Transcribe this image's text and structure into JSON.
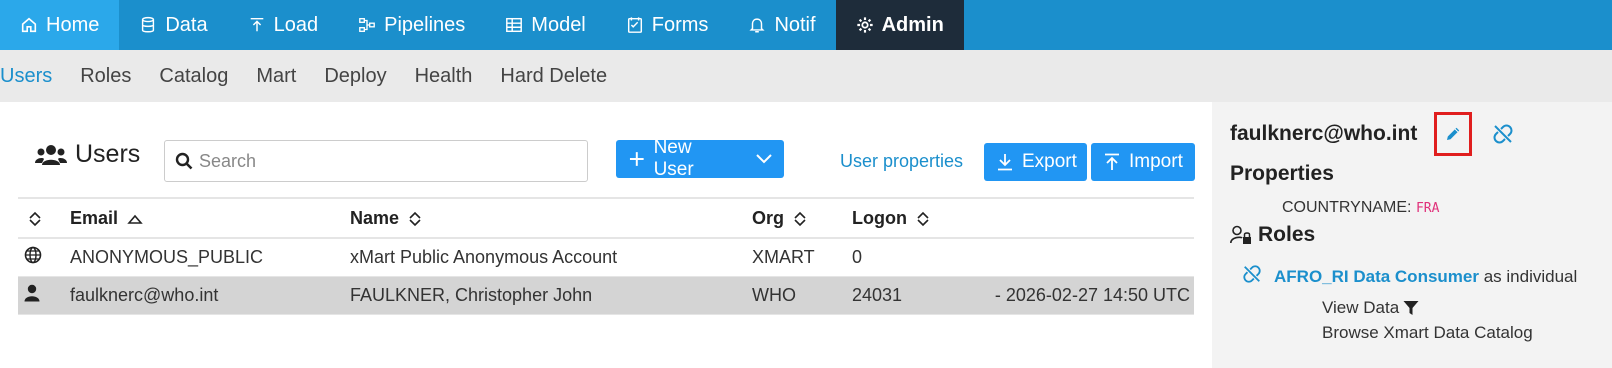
{
  "topnav": {
    "items": [
      {
        "label": "Home",
        "icon": "home-icon"
      },
      {
        "label": "Data",
        "icon": "database-icon"
      },
      {
        "label": "Load",
        "icon": "upload-icon"
      },
      {
        "label": "Pipelines",
        "icon": "pipeline-icon"
      },
      {
        "label": "Model",
        "icon": "table-icon"
      },
      {
        "label": "Forms",
        "icon": "form-icon"
      },
      {
        "label": "Notif",
        "icon": "bell-icon"
      },
      {
        "label": "Admin",
        "icon": "gear-icon"
      }
    ],
    "active": "Admin"
  },
  "subnav": {
    "tabs": [
      "Users",
      "Roles",
      "Catalog",
      "Mart",
      "Deploy",
      "Health",
      "Hard Delete"
    ],
    "active": "Users"
  },
  "users": {
    "title": "Users",
    "search_placeholder": "Search",
    "new_user_label": "New User",
    "user_properties_label": "User properties",
    "export_label": "Export",
    "import_label": "Import",
    "columns": [
      "Email",
      "Name",
      "Org",
      "Logon"
    ],
    "rows": [
      {
        "icon": "globe-icon",
        "email": "ANONYMOUS_PUBLIC",
        "name": "xMart Public Anonymous Account",
        "org": "XMART",
        "logon": "0",
        "last": ""
      },
      {
        "icon": "user-icon",
        "email": "faulknerc@who.int",
        "name": "FAULKNER, Christopher John",
        "org": "WHO",
        "logon": "24031",
        "last": "- 2026-02-27 14:50 UTC"
      }
    ]
  },
  "detail": {
    "email": "faulknerc@who.int",
    "properties_title": "Properties",
    "property_key": "COUNTRYNAME:",
    "property_value": "FRA",
    "roles_title": "Roles",
    "role_name": "AFRO_RI Data Consumer",
    "role_suffix": "as individual",
    "permission_1": "View Data",
    "permission_2": "Browse Xmart Data Catalog"
  },
  "colors": {
    "topnav_bg": "#1b8fcc",
    "home_bg": "#2ba8ea",
    "admin_bg": "#1e2c3a",
    "button_blue": "#2196f3",
    "highlight_red": "#e01e1e"
  }
}
